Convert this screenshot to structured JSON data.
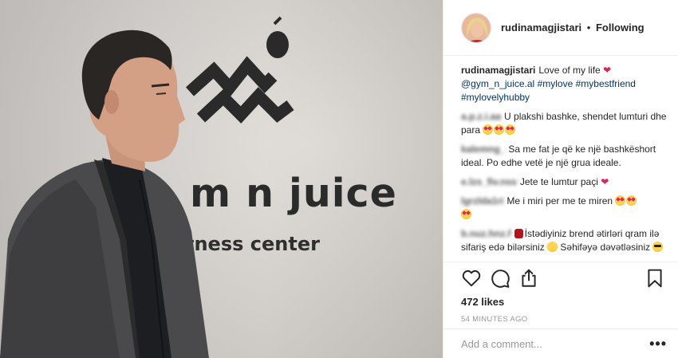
{
  "header": {
    "username": "rudinamagjistari",
    "separator": "•",
    "follow_status": "Following"
  },
  "photo": {
    "brand_text": "m n juice",
    "brand_sub": "tness center"
  },
  "caption": {
    "username": "rudinamagjistari",
    "text": "Love of my life",
    "tags": [
      "@gym_n_juice.al",
      "#mylove",
      "#mybestfriend",
      "#mylovelyhubby"
    ]
  },
  "comments": [
    {
      "text": "U plakshi bashke, shendet lumturi dhe para"
    },
    {
      "text": "Sa me fat je që ke një bashkëshort ideal. Po edhe vetë je një grua ideale."
    },
    {
      "text": "Jete te lumtur paçi"
    },
    {
      "text": "Me i miri per me te miren"
    },
    {
      "text": "İstədiyiniz brend ətirləri qram ilə sifariş edə bilərsiniz"
    },
    {
      "text": "Səhifəyə dəvətləsiniz"
    }
  ],
  "actions": {
    "likes": "472 likes",
    "time": "54 MINUTES AGO"
  },
  "add_comment": {
    "placeholder": "Add a comment...",
    "more": "•••"
  },
  "icons": {
    "like": "heart-icon",
    "comment": "comment-icon",
    "share": "share-icon",
    "save": "bookmark-icon"
  },
  "colors": {
    "link": "#003569",
    "heart": "#e0245e",
    "muted": "#999999"
  }
}
